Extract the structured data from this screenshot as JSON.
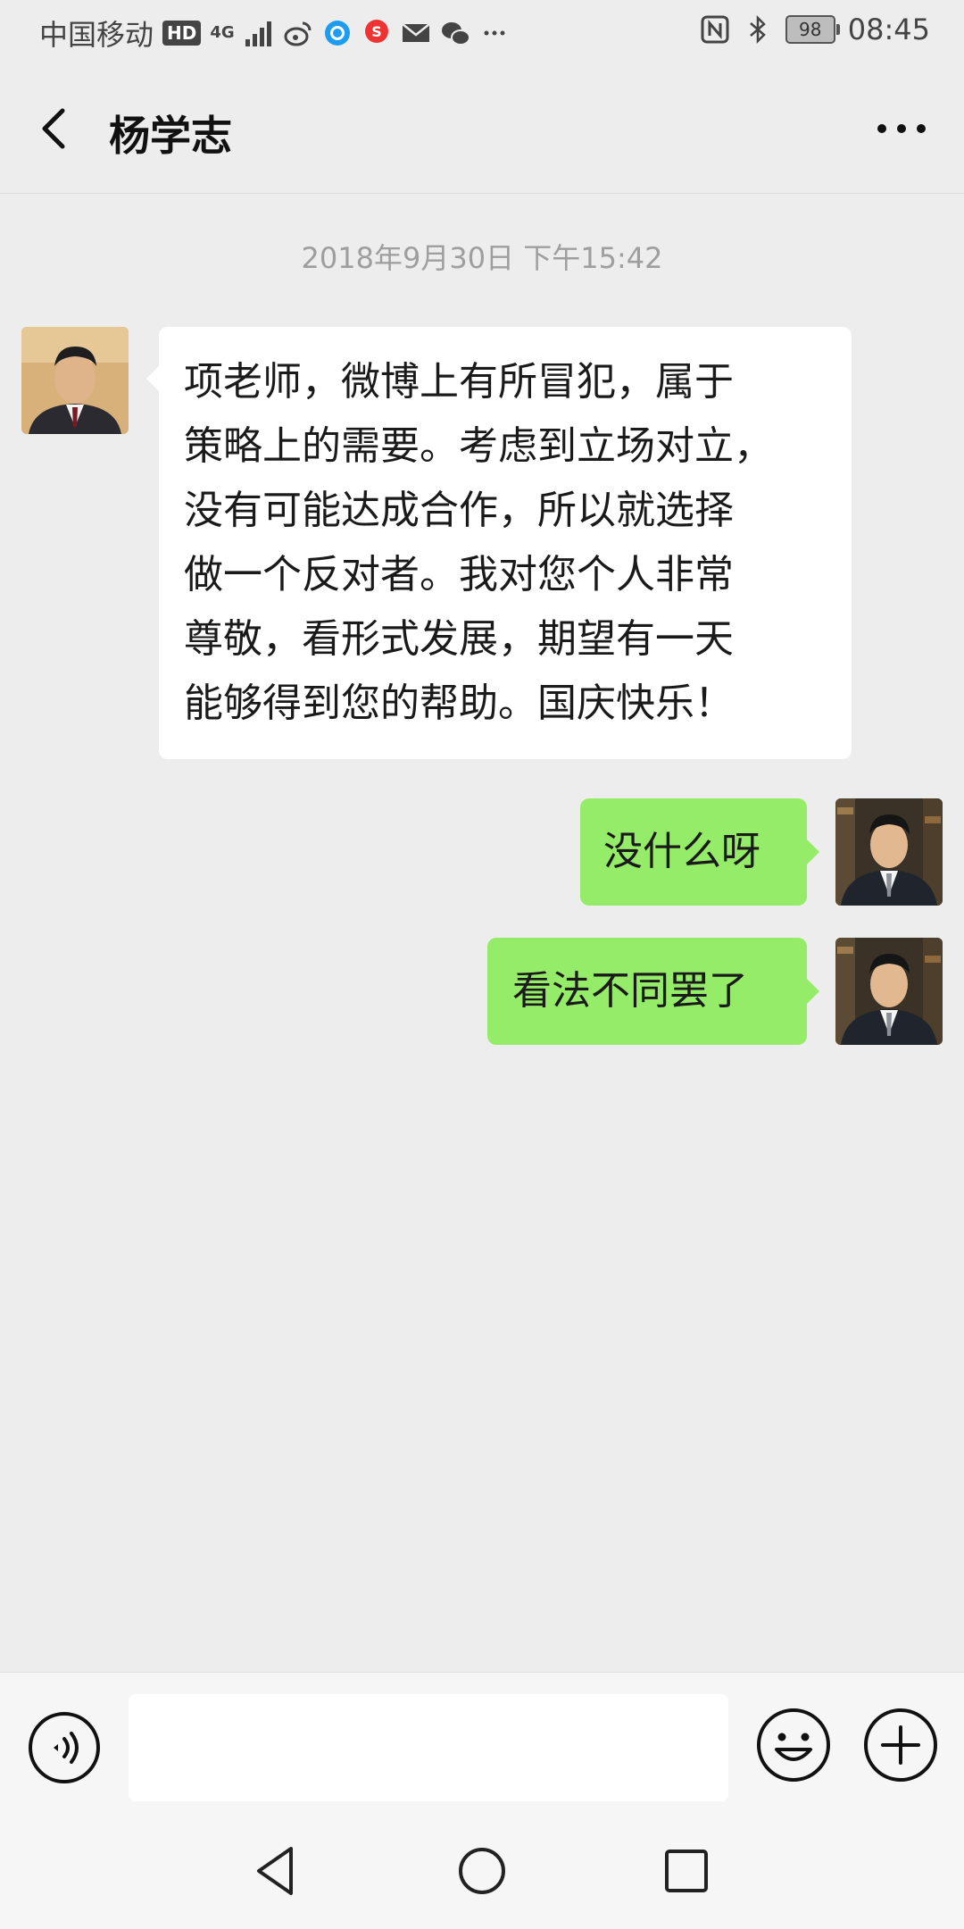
{
  "status_bar": {
    "carrier": "中国移动",
    "hd": "HD",
    "network": "4G",
    "battery": "98",
    "time": "08:45",
    "icons": [
      "signal-icon",
      "weibo-icon",
      "qq-browser-icon",
      "sogou-icon",
      "mail-icon",
      "wechat-icon",
      "more-dots-icon",
      "nfc-icon",
      "bluetooth-icon",
      "battery-icon"
    ]
  },
  "header": {
    "title": "杨学志"
  },
  "chat": {
    "timestamp": "2018年9月30日 下午15:42",
    "messages": [
      {
        "direction": "incoming",
        "lines": [
          "项老师，微博上有所冒犯，属于",
          "策略上的需要。考虑到立场对立，",
          "没有可能达成合作，所以就选择",
          "做一个反对者。我对您个人非常",
          "尊敬，看形式发展，期望有一天",
          "能够得到您的帮助。国庆快乐！"
        ]
      },
      {
        "direction": "outgoing",
        "text": "没什么呀"
      },
      {
        "direction": "outgoing",
        "text": "看法不同罢了"
      }
    ]
  },
  "input_bar": {
    "value": "",
    "icons": [
      "voice-icon",
      "emoji-icon",
      "plus-icon"
    ]
  },
  "nav": {
    "icons": [
      "nav-back-icon",
      "nav-home-icon",
      "nav-recents-icon"
    ]
  },
  "colors": {
    "background": "#ededed",
    "incoming_bubble": "#ffffff",
    "outgoing_bubble": "#95ec69",
    "timestamp": "#9e9e9e"
  }
}
